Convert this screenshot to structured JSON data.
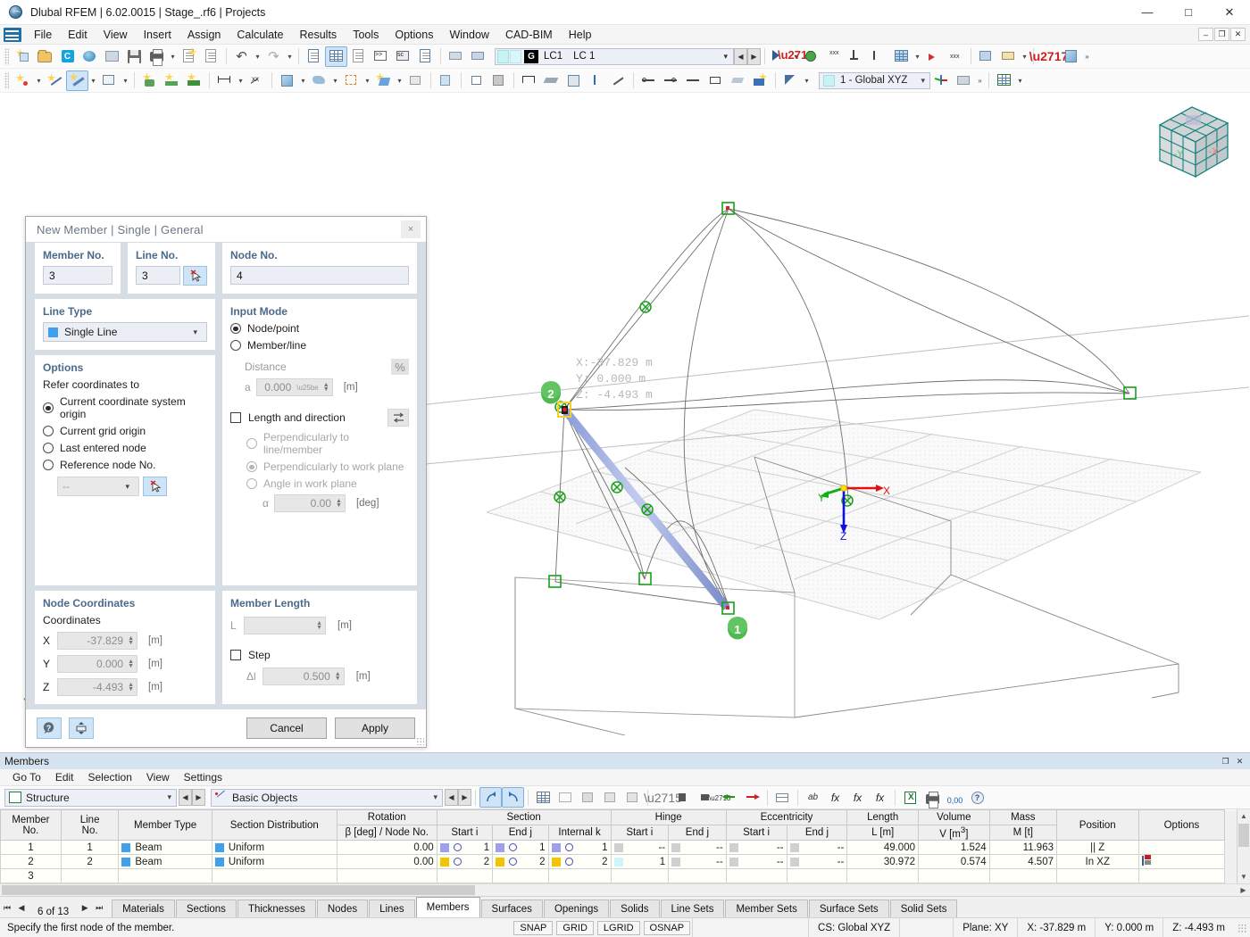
{
  "window": {
    "title": "Dlubal RFEM | 6.02.0015 | Stage_.rf6 | Projects",
    "minimize": "—",
    "maximize": "□",
    "close": "✕"
  },
  "menubar": {
    "items": [
      "File",
      "Edit",
      "View",
      "Insert",
      "Assign",
      "Calculate",
      "Results",
      "Tools",
      "Options",
      "Window",
      "CAD-BIM",
      "Help"
    ],
    "mini": [
      "–",
      "❐",
      "✕"
    ]
  },
  "toolbar": {
    "loadcase": {
      "g": "G",
      "lc_short": "LC1",
      "lc_name": "LC 1"
    },
    "coord_system": "1 - Global XYZ"
  },
  "dialog": {
    "title": "New Member | Single | General",
    "close": "×",
    "member_no": {
      "label": "Member No.",
      "value": "3"
    },
    "line_no": {
      "label": "Line No.",
      "value": "3"
    },
    "node_no": {
      "label": "Node No.",
      "value": "4"
    },
    "line_type": {
      "label": "Line Type",
      "value": "Single Line"
    },
    "input_mode": {
      "label": "Input Mode",
      "options": [
        "Node/point",
        "Member/line"
      ],
      "selected": "Node/point",
      "distance_label": "Distance",
      "percent": "%",
      "a_label": "a",
      "a_value": "0.000",
      "a_unit": "[m]"
    },
    "options": {
      "label": "Options",
      "refer_label": "Refer coordinates to",
      "items": [
        "Current coordinate system origin",
        "Current grid origin",
        "Last entered node",
        "Reference node No."
      ],
      "selected": "Current coordinate system origin",
      "ref_node_value": "--"
    },
    "length_direction": {
      "label": "Length and direction",
      "checked": false,
      "options": [
        "Perpendicularly to line/member",
        "Perpendicularly to work plane",
        "Angle in work plane"
      ],
      "selected": "Perpendicularly to work plane",
      "alpha_label": "α",
      "alpha_value": "0.00",
      "alpha_unit": "[deg]"
    },
    "node_coordinates": {
      "label": "Node Coordinates",
      "sub_label": "Coordinates",
      "rows": [
        {
          "axis": "X",
          "value": "-37.829",
          "unit": "[m]"
        },
        {
          "axis": "Y",
          "value": "0.000",
          "unit": "[m]"
        },
        {
          "axis": "Z",
          "value": "-4.493",
          "unit": "[m]"
        }
      ]
    },
    "member_length": {
      "label": "Member Length",
      "l_label": "L",
      "l_value": "",
      "l_unit": "[m]",
      "step_label": "Step",
      "step_checked": false,
      "dl_label": "Δl",
      "dl_value": "0.500",
      "dl_unit": "[m]"
    },
    "buttons": {
      "cancel": "Cancel",
      "apply": "Apply"
    }
  },
  "viewport": {
    "tooltip": {
      "x": "X:-37.829 m",
      "y": "Y:  0.000 m",
      "z": "Z: -4.493 m"
    },
    "node_labels": [
      "1",
      "2"
    ],
    "axes": {
      "x": "X",
      "y": "Y",
      "z": "Z"
    },
    "viewcube": {
      "face_left": "-Y",
      "face_right": "-X"
    }
  },
  "members_panel": {
    "title": "Members",
    "menu": [
      "Go To",
      "Edit",
      "Selection",
      "View",
      "Settings"
    ],
    "filter_structure": "Structure",
    "filter_objects": "Basic Objects",
    "table": {
      "headers_top": [
        "Member\nNo.",
        "Line\nNo.",
        "Member Type",
        "Section Distribution",
        "Rotation",
        "Section",
        "Hinge",
        "Eccentricity",
        "Length",
        "Volume",
        "Mass",
        "Position",
        "Options"
      ],
      "columns": [
        {
          "group": "",
          "title": "Member No."
        },
        {
          "group": "",
          "title": "Line No."
        },
        {
          "group": "",
          "title": "Member Type"
        },
        {
          "group": "",
          "title": "Section Distribution"
        },
        {
          "group": "",
          "title": "Rotation",
          "sub": "β [deg] / Node No."
        },
        {
          "group": "Section",
          "sub": "Start i"
        },
        {
          "group": "Section",
          "sub": "End j"
        },
        {
          "group": "Section",
          "sub": "Internal k"
        },
        {
          "group": "Hinge",
          "sub": "Start i"
        },
        {
          "group": "Hinge",
          "sub": "End j"
        },
        {
          "group": "Eccentricity",
          "sub": "Start i"
        },
        {
          "group": "Eccentricity",
          "sub": "End j"
        },
        {
          "group": "Length",
          "sub": "L [m]"
        },
        {
          "group": "Volume",
          "sub": "V [m³]"
        },
        {
          "group": "Mass",
          "sub": "M [t]"
        },
        {
          "group": "",
          "title": "Position"
        },
        {
          "group": "",
          "title": "Options"
        }
      ],
      "rows": [
        {
          "member_no": "1",
          "line_no": "1",
          "member_type": "Beam",
          "member_type_color": "#3fa0ef",
          "section_distribution": "Uniform",
          "section_distribution_color": "#3fa0ef",
          "rotation": "0.00",
          "section_start": "1",
          "section_end": "1",
          "section_internal": "1",
          "section_color": "#9f9ff0",
          "hinge_start": "--",
          "hinge_end": "--",
          "ecc_start": "--",
          "ecc_end": "--",
          "length": "49.000",
          "volume": "1.524",
          "mass": "11.963",
          "position": "|| Z",
          "options": ""
        },
        {
          "member_no": "2",
          "line_no": "2",
          "member_type": "Beam",
          "member_type_color": "#3fa0ef",
          "section_distribution": "Uniform",
          "section_distribution_color": "#3fa0ef",
          "rotation": "0.00",
          "section_start": "2",
          "section_end": "2",
          "section_internal": "2",
          "section_color": "#f5c400",
          "hinge_start": "1",
          "hinge_end": "--",
          "ecc_start": "--",
          "ecc_end": "--",
          "length": "30.972",
          "volume": "0.574",
          "mass": "4.507",
          "position": "In XZ",
          "options": "flag-icon"
        },
        {
          "member_no": "3",
          "line_no": "",
          "member_type": "",
          "section_distribution": "",
          "rotation": "",
          "section_start": "",
          "section_end": "",
          "section_internal": "",
          "hinge_start": "",
          "hinge_end": "",
          "ecc_start": "",
          "ecc_end": "",
          "length": "",
          "volume": "",
          "mass": "",
          "position": "",
          "options": ""
        }
      ]
    },
    "pager": "6 of 13",
    "tabs": [
      "Materials",
      "Sections",
      "Thicknesses",
      "Nodes",
      "Lines",
      "Members",
      "Surfaces",
      "Openings",
      "Solids",
      "Line Sets",
      "Member Sets",
      "Surface Sets",
      "Solid Sets"
    ],
    "selected_tab": "Members"
  },
  "statusbar": {
    "message": "Specify the first node of the member.",
    "toggles": [
      "SNAP",
      "GRID",
      "LGRID",
      "OSNAP"
    ],
    "cs": "CS: Global XYZ",
    "plane": "Plane: XY",
    "x": "X: -37.829 m",
    "y": "Y: 0.000 m",
    "z": "Z: -4.493 m"
  }
}
